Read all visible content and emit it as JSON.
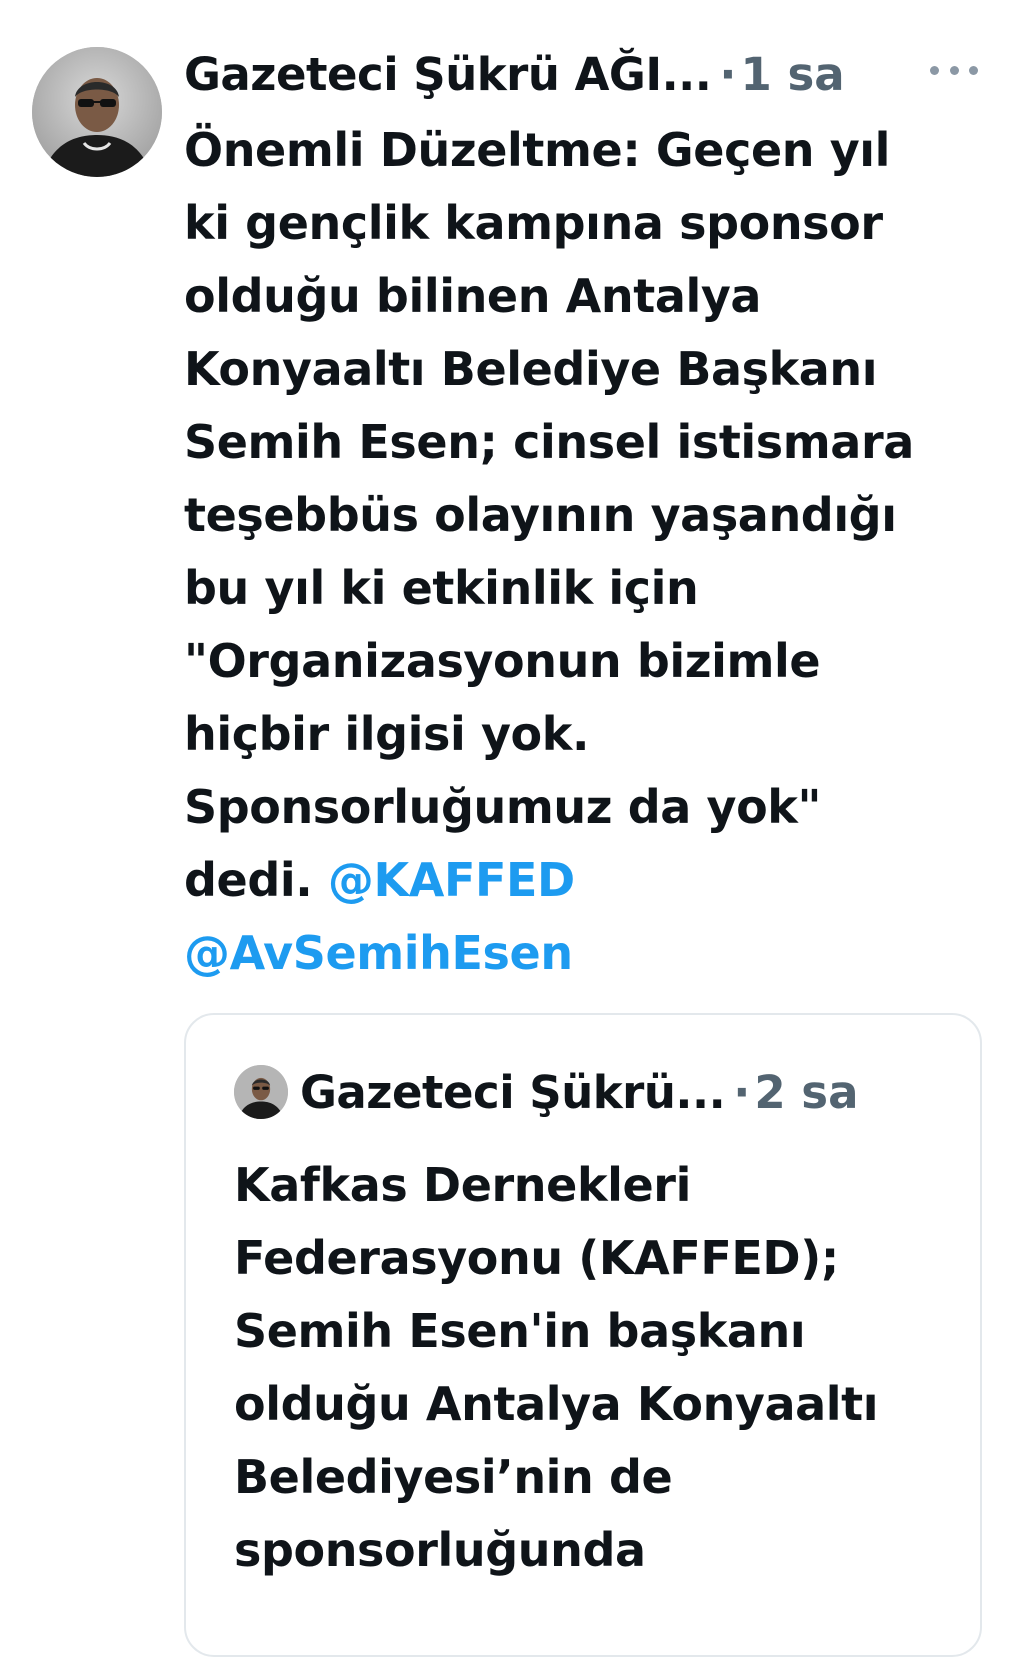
{
  "tweet": {
    "author": "Gazeteci Şükrü AĞI...",
    "separator": "·",
    "time": "1 sa",
    "body_lines": [
      "Önemli Düzeltme: Geçen yıl",
      "ki gençlik kampına sponsor",
      "olduğu bilinen Antalya",
      "Konyaaltı Belediye Başkanı",
      "Semih Esen; cinsel istismara",
      "teşebbüs olayının yaşandığı",
      "bu yıl ki etkinlik için",
      "\"Organizasyonun bizimle",
      "hiçbir ilgisi yok.",
      "Sponsorluğumuz da yok\""
    ],
    "last_line_text": "dedi.",
    "mention_1": "@KAFFED",
    "mention_2": "@AvSemihEsen",
    "more_icon": "more-horizontal-icon",
    "mention_color": "#1d9bf0"
  },
  "quote": {
    "author": "Gazeteci Şükrü...",
    "separator": "·",
    "time": "2 sa",
    "body_lines": [
      "Kafkas Dernekleri",
      "Federasyonu (KAFFED);",
      "Semih Esen'in başkanı",
      "olduğu Antalya Konyaaltı",
      "Belediyesi’nin de",
      "sponsorluğunda"
    ]
  }
}
